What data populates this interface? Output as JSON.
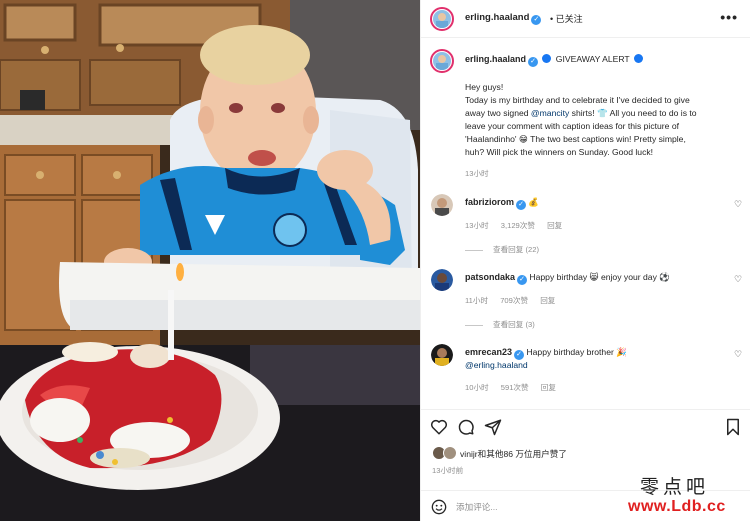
{
  "post": {
    "author": "erling.haaland",
    "follow_status": "• 已关注",
    "more_label": "•••"
  },
  "caption": {
    "author": "erling.haaland",
    "title_suffix": "GIVEAWAY ALERT",
    "lines": [
      "Hey guys!",
      "Today is my birthday and to celebrate it I've decided to give",
      "shirts!",
      "All you need to do is to",
      "leave your comment with caption ideas for this picture of",
      "'Haalandinho'",
      "The two best captions win! Pretty simple,",
      "huh? Will pick the winners on Sunday. Good luck!"
    ],
    "line2_prefix": "away two signed ",
    "mention": "@mancity",
    "time": "13小时"
  },
  "comments": [
    {
      "author": "fabriziorom",
      "text": "",
      "time": "13小时",
      "likes": "3,129次赞",
      "reply": "回复",
      "view_replies": "查看回复 (22)"
    },
    {
      "author": "patsondaka",
      "text": "Happy birthday",
      "text_tail": "enjoy your day",
      "time": "11小时",
      "likes": "709次赞",
      "reply": "回复",
      "view_replies": "查看回复 (3)"
    },
    {
      "author": "emrecan23",
      "text": "Happy birthday brother",
      "mention": "@erling.haaland",
      "time": "10小时",
      "likes": "591次赞",
      "reply": "回复"
    }
  ],
  "likes": {
    "text": "vinijr和其他86 万位用户赞了",
    "post_time": "13小时前"
  },
  "comment_box": {
    "placeholder": "添加评论..."
  },
  "watermark": {
    "top": "零点吧",
    "bottom": "www.Ldb.cc"
  },
  "icons": [
    "more-icon",
    "verified-icon",
    "heart-icon",
    "comment-icon",
    "share-icon",
    "bookmark-icon",
    "emoji-icon"
  ],
  "colors": {
    "verified": "#3897f0",
    "mention": "#00376b",
    "secondary_text": "#8e8e8e",
    "story_ring": "#e1306c",
    "watermark_red": "#e02020"
  }
}
